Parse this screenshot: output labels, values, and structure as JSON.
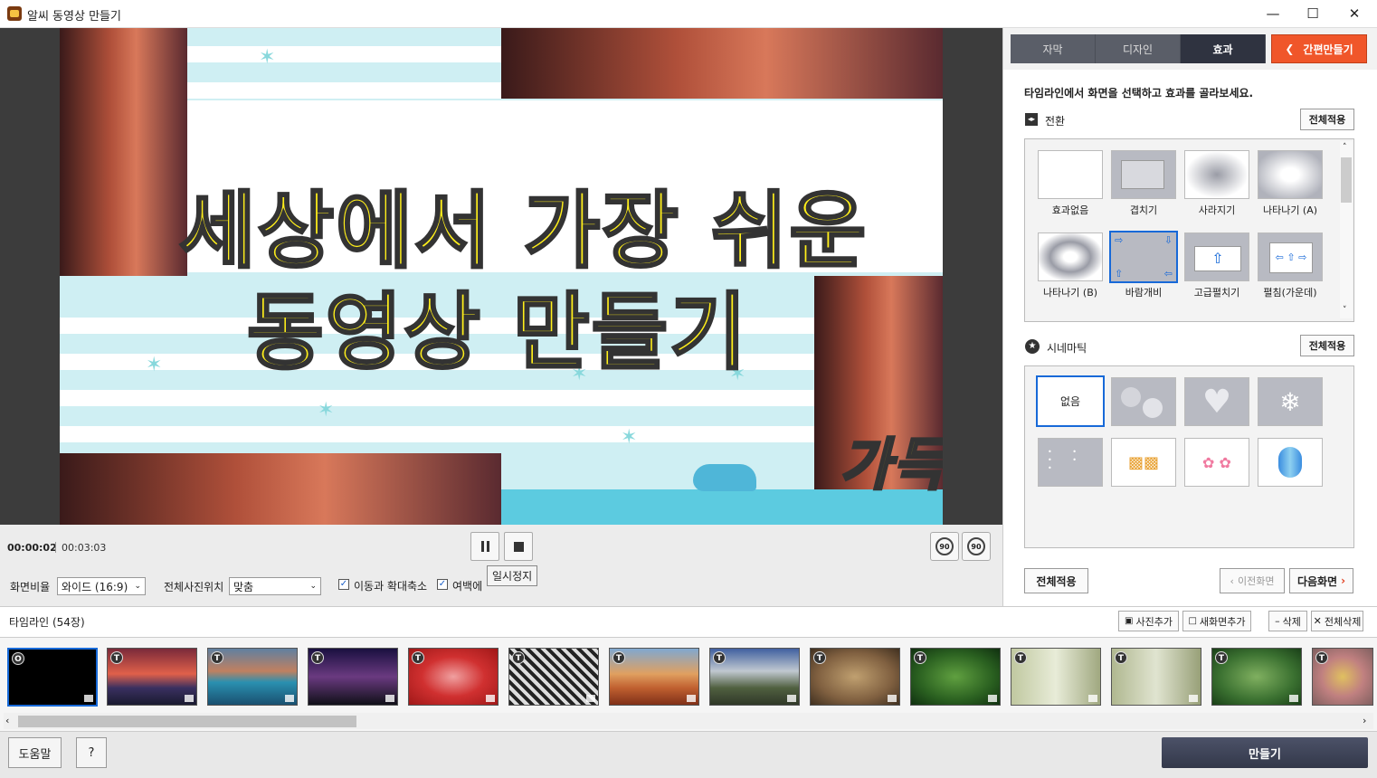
{
  "window": {
    "title": "알씨 동영상 만들기"
  },
  "preview": {
    "line1": "세상에서 가장 쉬운",
    "line2": "동영상 만들기",
    "overlay": "가득"
  },
  "player": {
    "current_time": "00:00:02",
    "total_time": "00:03:03",
    "pause_tooltip": "일시정지",
    "rotate_left_label": "90",
    "rotate_right_label": "90"
  },
  "options": {
    "aspect_label": "화면비율",
    "aspect_value": "와이드 (16:9)",
    "position_label": "전체사진위치",
    "position_value": "맞춤",
    "motion_label": "이동과 확대축소",
    "motion_checked": true,
    "margin_label": "여백에 사진",
    "margin_checked": true
  },
  "panel": {
    "tabs": [
      {
        "label": "자막",
        "active": false
      },
      {
        "label": "디자인",
        "active": false
      },
      {
        "label": "효과",
        "active": true
      }
    ],
    "easy_button": "간편만들기",
    "instruction": "타임라인에서 화면을 선택하고 효과를 골라보세요.",
    "transition_title": "전환",
    "apply_all": "전체적용",
    "transitions": [
      {
        "label": "효과없음",
        "icon": "blank-icon"
      },
      {
        "label": "겹치기",
        "icon": "overlap-icon"
      },
      {
        "label": "사라지기",
        "icon": "fade-out-icon"
      },
      {
        "label": "나타나기 (A)",
        "icon": "fade-in-a-icon"
      },
      {
        "label": "나타나기 (B)",
        "icon": "fade-in-b-icon"
      },
      {
        "label": "바람개비",
        "icon": "pinwheel-icon",
        "selected": true
      },
      {
        "label": "고급펼치기",
        "icon": "unfold-icon"
      },
      {
        "label": "펼침(가운데)",
        "icon": "unfold-center-icon"
      }
    ],
    "cinematic_title": "시네마틱",
    "cinematic": [
      {
        "label": "없음",
        "selected": true
      },
      {
        "icon": "bokeh-icon"
      },
      {
        "icon": "hearts-icon"
      },
      {
        "icon": "snowflake-icon"
      },
      {
        "icon": "dots-icon"
      },
      {
        "icon": "gift-icon"
      },
      {
        "icon": "flowers-icon"
      },
      {
        "icon": "balloon-icon"
      }
    ],
    "apply_all_bottom": "전체적용",
    "prev_screen": "이전화면",
    "next_screen": "다음화면"
  },
  "timeline": {
    "title": "타임라인 (54장)",
    "add_photo": "사진추가",
    "add_new_screen": "새화면추가",
    "delete": "삭제",
    "delete_all": "전체삭제",
    "badge_first": "O",
    "badge_other": "T"
  },
  "bottom": {
    "help": "도움말",
    "question": "?",
    "make": "만들기"
  }
}
